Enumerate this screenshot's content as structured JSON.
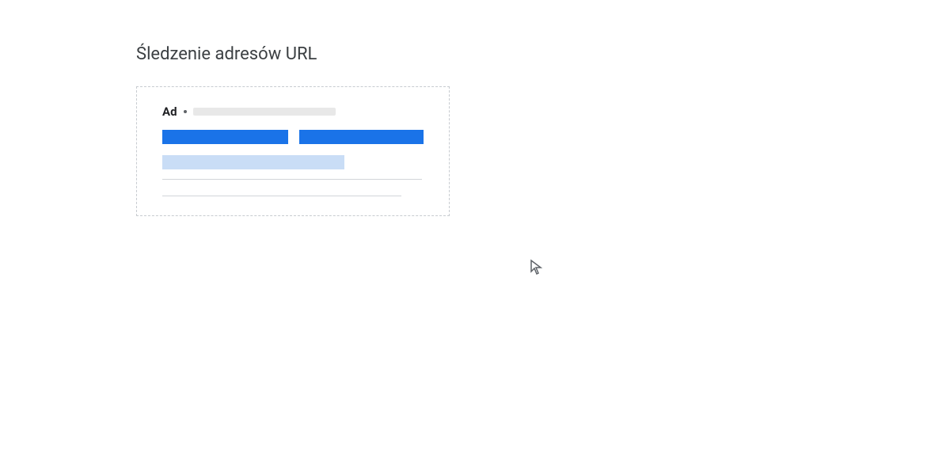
{
  "section": {
    "title": "Śledzenie adresów URL"
  },
  "adPreview": {
    "label": "Ad"
  }
}
